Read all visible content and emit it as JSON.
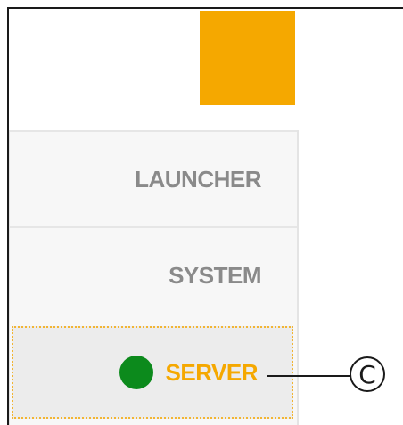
{
  "colors": {
    "brand": "#f5a800",
    "status_online": "#0c8a1c",
    "menu_text": "#8a8a8a",
    "menu_background": "#f7f7f7",
    "selected_background": "#ececec"
  },
  "brand_block": {
    "icon": "brand-logo-square"
  },
  "menu": {
    "items": [
      {
        "label": "LAUNCHER",
        "selected": false
      },
      {
        "label": "SYSTEM",
        "selected": false
      },
      {
        "label": "SERVER",
        "selected": true,
        "status_icon": "status-dot-icon",
        "status": "online"
      }
    ]
  },
  "callout": {
    "label": "C"
  }
}
